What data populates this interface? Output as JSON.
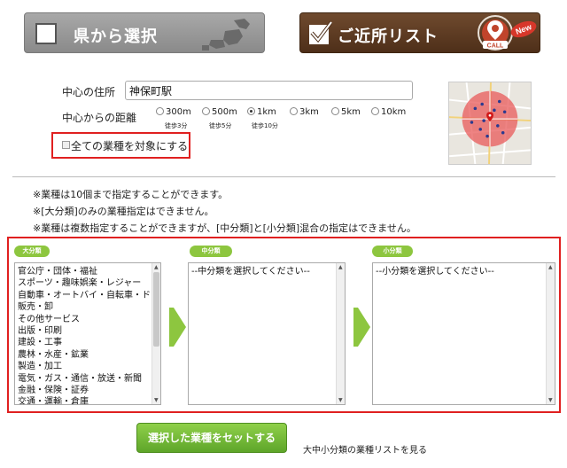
{
  "header": {
    "pref_button_label": "県から選択",
    "near_button_label": "ご近所リスト",
    "near_badge": "New",
    "pin_label": "CALL"
  },
  "form": {
    "address_label": "中心の住所",
    "address_value": "神保町駅",
    "distance_label": "中心からの距離",
    "distance_options": [
      {
        "label": "300m",
        "walk": "徒歩3分",
        "selected": false
      },
      {
        "label": "500m",
        "walk": "徒歩5分",
        "selected": false
      },
      {
        "label": "1km",
        "walk": "徒歩10分",
        "selected": true
      },
      {
        "label": "3km",
        "walk": "",
        "selected": false
      },
      {
        "label": "5km",
        "walk": "",
        "selected": false
      },
      {
        "label": "10km",
        "walk": "",
        "selected": false
      }
    ],
    "all_categories_label": "全ての業種を対象にする"
  },
  "notes": [
    "※業種は10個まで指定することができます。",
    "※[大分類]のみの業種指定はできません。",
    "※業種は複数指定することができますが、[中分類]と[小分類]混合の指定はできません。"
  ],
  "categories": {
    "large_title": "大分類",
    "medium_title": "中分類",
    "small_title": "小分類",
    "large_items": [
      "官公庁・団体・福祉",
      "スポーツ・趣味娯楽・レジャー",
      "自動車・オートバイ・自転車・ドライブ",
      "販売・卸",
      "その他サービス",
      "出版・印刷",
      "建設・工事",
      "農林・水産・鉱業",
      "製造・加工",
      "電気・ガス・通信・放送・新聞",
      "金融・保険・証券",
      "交通・運輸・倉庫"
    ],
    "medium_placeholder": "--中分類を選択してください--",
    "small_placeholder": "--小分類を選択してください--"
  },
  "actions": {
    "set_button": "選択した業種をセットする",
    "list_link": "大中小分類の業種リストを見る"
  },
  "colors": {
    "accent_green": "#8dc63f",
    "highlight_red": "#e02020",
    "brown": "#5a3820",
    "gray_button": "#999999"
  }
}
